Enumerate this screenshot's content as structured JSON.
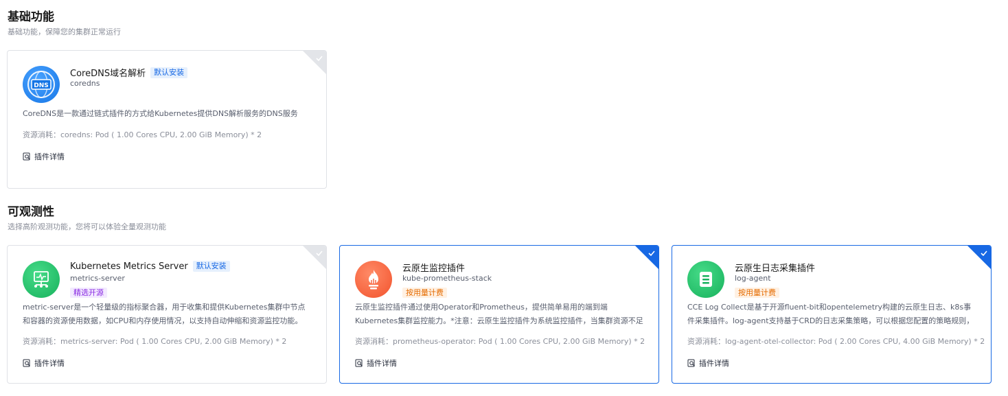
{
  "sections": [
    {
      "title": "基础功能",
      "desc": "基础功能，保障您的集群正常运行",
      "cards": [
        {
          "name": "CoreDNS域名解析",
          "tag": "默认安装",
          "subname": "coredns",
          "desc": "CoreDNS是一款通过链式插件的方式给Kubernetes提供DNS解析服务的DNS服务器。",
          "resource": "资源消耗：coredns: Pod ( 1.00 Cores CPU, 2.00 GiB Memory) * 2",
          "detail": "插件详情",
          "logo_text": "DNS"
        }
      ]
    },
    {
      "title": "可观测性",
      "desc": "选择高阶观测功能，您将可以体验全量观测功能",
      "cards": [
        {
          "name": "Kubernetes Metrics Server",
          "tag": "默认安装",
          "subname": "metrics-server",
          "subtag": "精选开源",
          "desc": "metric-server是一个轻量级的指标聚合器，用于收集和提供Kubernetes集群中节点和容器的资源使用数据，如CPU和内存使用情况，以支持自动伸缩和资源监控功能。",
          "resource": "资源消耗：metrics-server: Pod ( 1.00 Cores CPU, 2.00 GiB Memory) * 2",
          "detail": "插件详情"
        },
        {
          "name": "云原生监控插件",
          "subname": "kube-prometheus-stack",
          "subtag": "按用量计费",
          "desc": "云原生监控插件通过使用Operator和Prometheus，提供简单易用的端到端Kubernetes集群监控能力。*注意：云原生监控插件为系统监控插件，当集群资源不足时，Kubernetes",
          "resource": "资源消耗：prometheus-operator: Pod ( 1.00 Cores CPU, 2.00 GiB Memory) * 2",
          "detail": "插件详情"
        },
        {
          "name": "云原生日志采集插件",
          "subname": "log-agent",
          "subtag": "按用量计费",
          "desc": "CCE Log Collect是基于开源fluent-bit和opentelemetry构建的云原生日志、k8s事件采集插件。log-agent支持基于CRD的日志采集策略，可以根据您配置的策略规则，对集群中",
          "resource": "资源消耗：log-agent-otel-collector: Pod ( 2.00 Cores CPU, 4.00 GiB Memory) * 2",
          "detail": "插件详情"
        }
      ]
    }
  ]
}
